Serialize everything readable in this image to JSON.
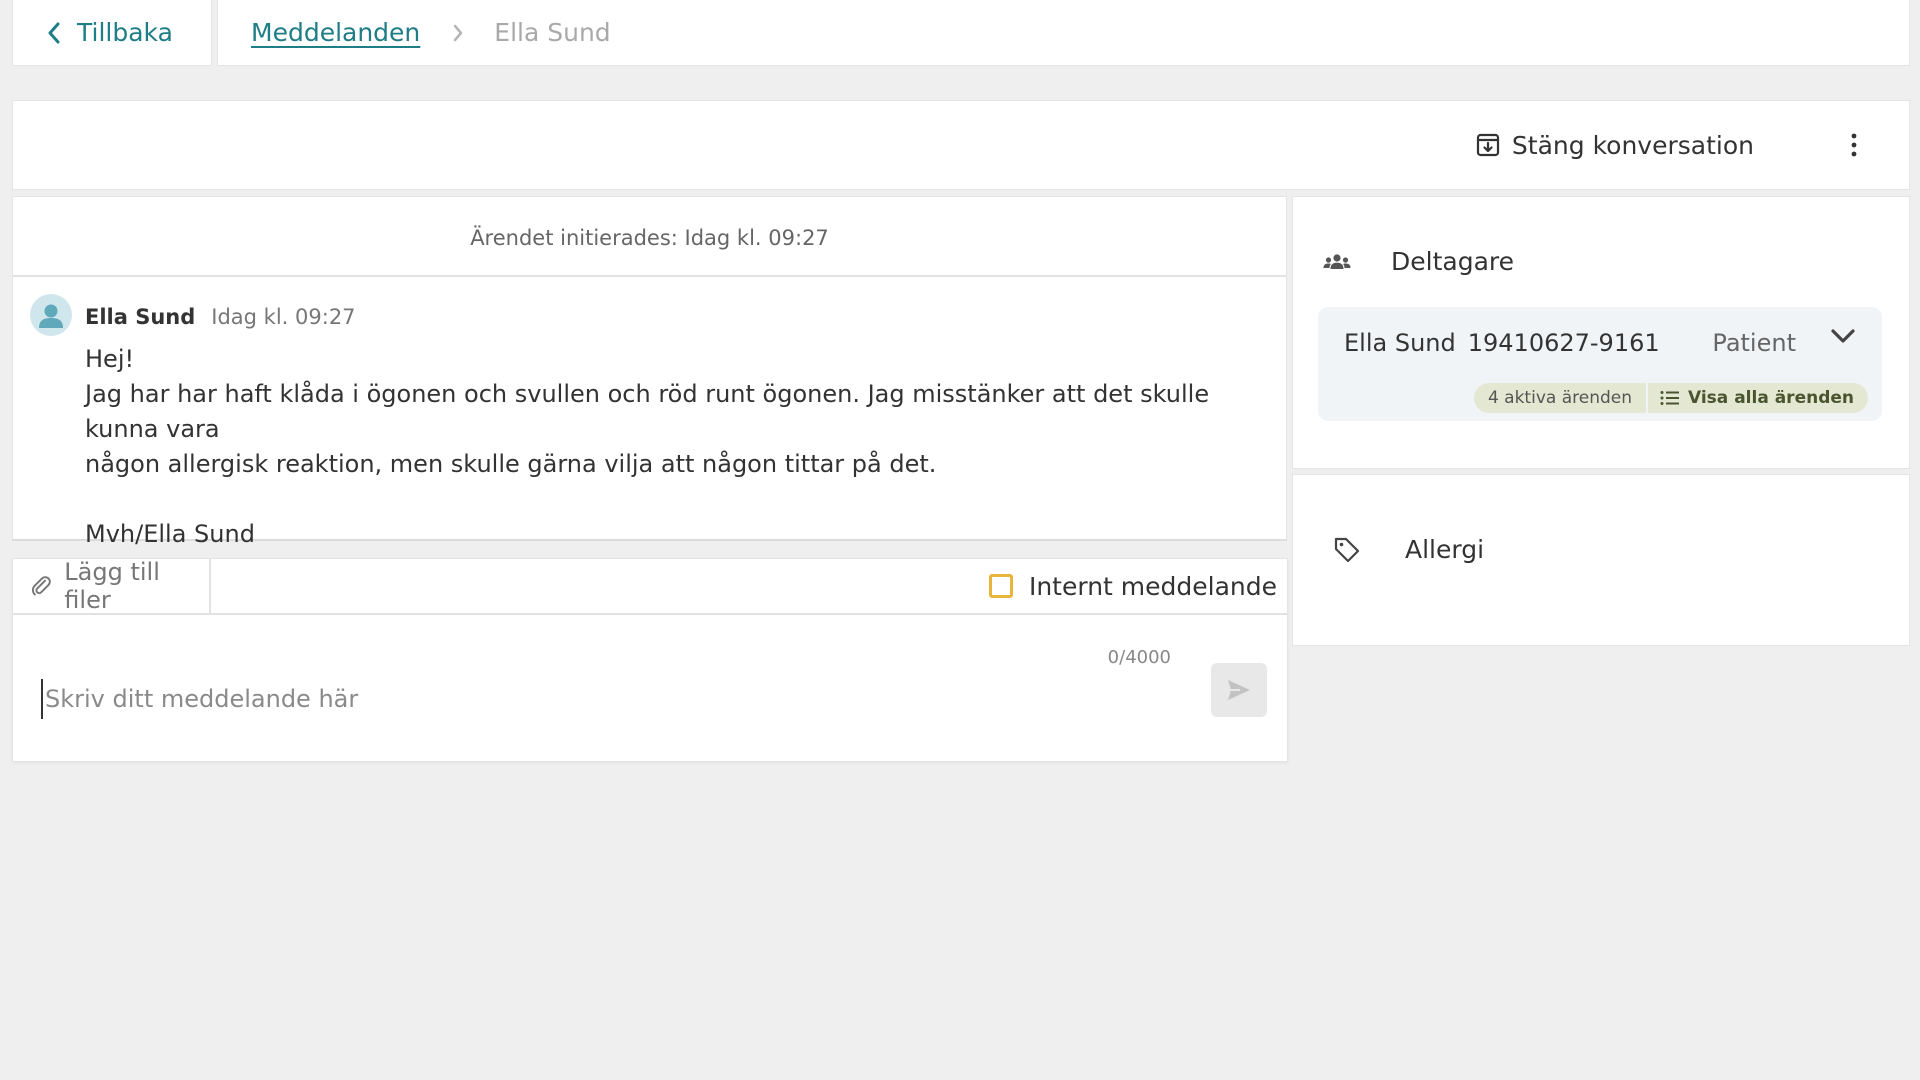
{
  "topbar": {
    "back_label": "Tillbaka",
    "breadcrumb": {
      "parent": "Meddelanden",
      "current": "Ella Sund"
    }
  },
  "actions": {
    "close_conversation": "Stäng konversation"
  },
  "thread": {
    "initiated": "Ärendet initierades: Idag kl. 09:27",
    "messages": [
      {
        "author": "Ella Sund",
        "time": "Idag kl. 09:27",
        "lines": [
          "Hej!",
          "Jag har har haft klåda i ögonen och svullen och röd runt ögonen. Jag misstänker att det skulle kunna vara",
          "någon allergisk reaktion, men skulle gärna vilja att någon tittar på det.",
          "",
          "Mvh/Ella Sund"
        ]
      }
    ]
  },
  "composer": {
    "attach_label": "Lägg till filer",
    "internal_label": "Internt meddelande",
    "counter": "0/4000",
    "placeholder": "Skriv ditt meddelande här",
    "value": ""
  },
  "participants": {
    "title": "Deltagare",
    "items": [
      {
        "name": "Ella Sund",
        "personal_number": "19410627-9161",
        "role": "Patient",
        "active_cases": "4 aktiva ärenden",
        "show_all": "Visa alla ärenden"
      }
    ]
  },
  "tags": {
    "items": [
      "Allergi"
    ]
  },
  "colors": {
    "accent": "#1e7d86",
    "checkbox_border": "#e8b53a",
    "chip_bg": "#e4e7d2",
    "card_bg": "#f1f4f7"
  }
}
